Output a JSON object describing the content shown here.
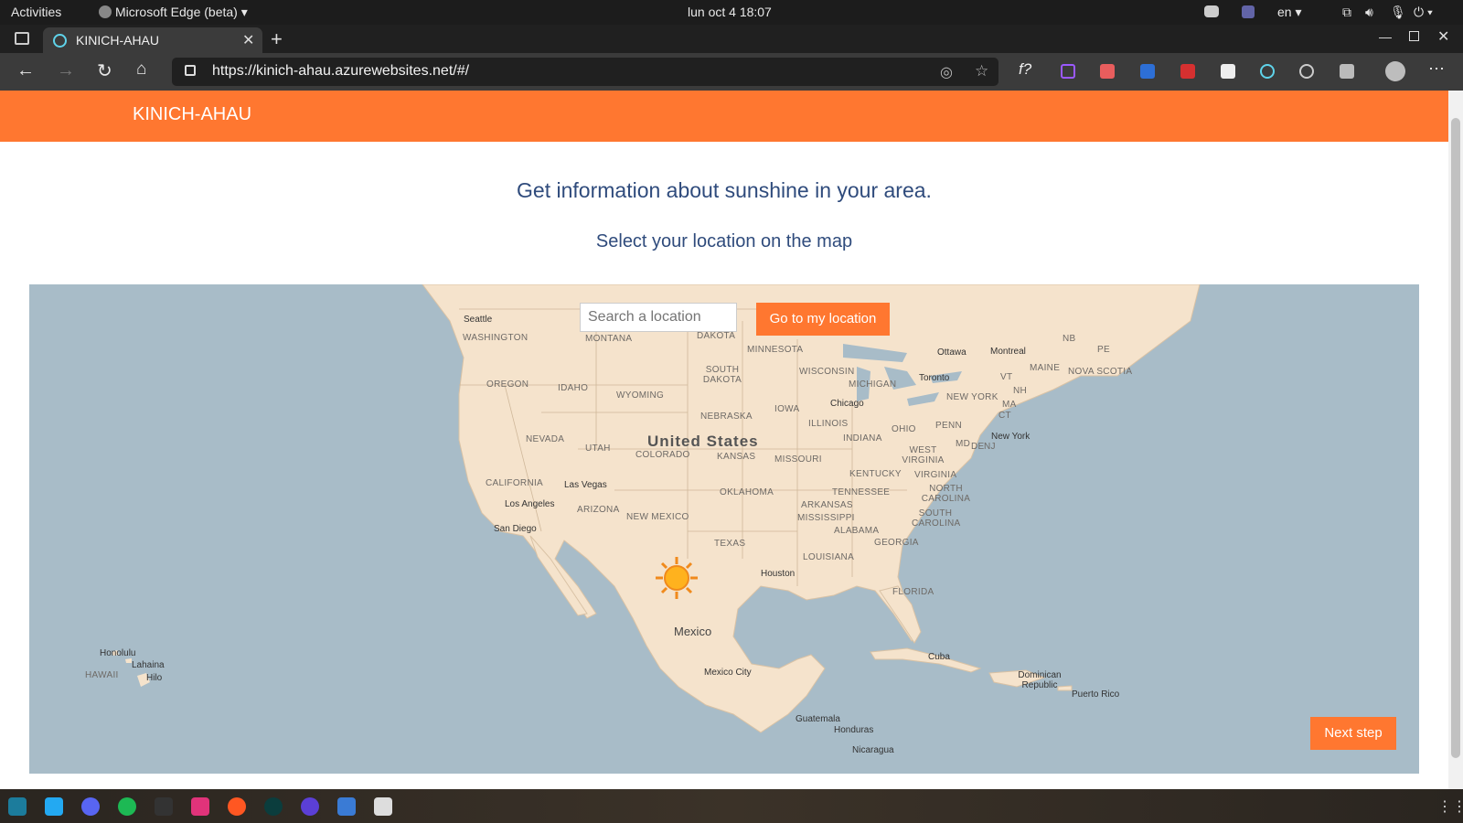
{
  "system_bar": {
    "activities": "Activities",
    "app_name": "Microsoft Edge (beta)",
    "clock": "lun oct 4  18:07",
    "language": "en"
  },
  "browser": {
    "tab_title": "KINICH-AHAU",
    "url": "https://kinich-ahau.azurewebsites.net/#/"
  },
  "page": {
    "brand": "KINICH-AHAU",
    "heading": "Get information about sunshine in your area.",
    "subheading": "Select your location on the map",
    "search_placeholder": "Search a location",
    "go_button": "Go to my location",
    "next_button": "Next step"
  },
  "map_labels": {
    "country_us": "United States",
    "country_mexico": "Mexico",
    "states": [
      "WASHINGTON",
      "MONTANA",
      "DAKOTA",
      "MINNESOTA",
      "OREGON",
      "IDAHO",
      "WYOMING",
      "SOUTH DAKOTA",
      "WISCONSIN",
      "MICHIGAN",
      "NEBRASKA",
      "IOWA",
      "ILLINOIS",
      "INDIANA",
      "OHIO",
      "PENN",
      "NEVADA",
      "UTAH",
      "COLORADO",
      "KANSAS",
      "MISSOURI",
      "KENTUCKY",
      "WEST VIRGINIA",
      "VIRGINIA",
      "CALIFORNIA",
      "ARIZONA",
      "NEW MEXICO",
      "OKLAHOMA",
      "ARKANSAS",
      "TENNESSEE",
      "NORTH CAROLINA",
      "MISSISSIPPI",
      "ALABAMA",
      "GEORGIA",
      "SOUTH CAROLINA",
      "TEXAS",
      "LOUISIANA",
      "FLORIDA",
      "MAINE",
      "NOVA SCOTIA",
      "NEW YORK",
      "VT",
      "NH",
      "MA",
      "CT",
      "MD",
      "DE",
      "NJ",
      "NB",
      "PE",
      "HAWAII"
    ],
    "cities": [
      "Seattle",
      "Las Vegas",
      "Los Angeles",
      "San Diego",
      "Houston",
      "Chicago",
      "Toronto",
      "Ottawa",
      "Montreal",
      "New York",
      "Mexico City",
      "Cuba",
      "Dominican Republic",
      "Puerto Rico",
      "Guatemala",
      "Honduras",
      "Nicaragua",
      "Honolulu",
      "Lahaina",
      "Hilo"
    ]
  },
  "colors": {
    "accent": "#ff7730",
    "heading": "#2f4b7c",
    "ocean": "#a8bcc8",
    "land": "#f5e3cc"
  }
}
